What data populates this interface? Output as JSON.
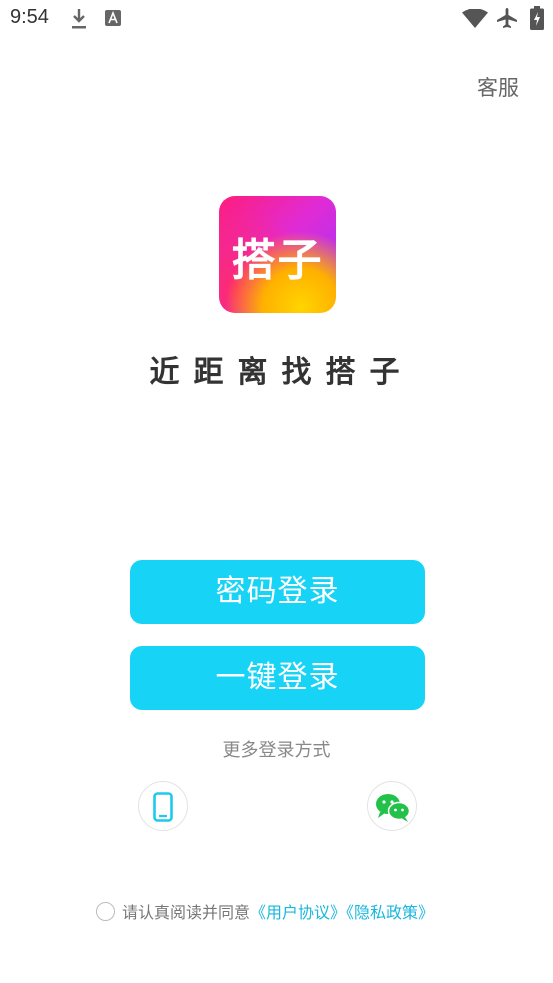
{
  "status_bar": {
    "time": "9:54",
    "icons": [
      "download-icon",
      "font-icon",
      "wifi-icon",
      "airplane-mode-icon",
      "battery-charging-icon"
    ]
  },
  "header": {
    "service_label": "客服"
  },
  "logo": {
    "text": "搭子"
  },
  "slogan": "近距离找搭子",
  "buttons": {
    "password_login": "密码登录",
    "one_key_login": "一键登录"
  },
  "more_login": {
    "label": "更多登录方式",
    "methods": [
      "phone-icon",
      "wechat-icon"
    ]
  },
  "agreement": {
    "prefix": "请认真阅读并同意",
    "user_agreement": "《用户协议》",
    "privacy_policy": "《隐私政策》",
    "checked": false
  },
  "colors": {
    "accent": "#17d3f5",
    "link": "#19b7dd",
    "wechat_green": "#22c24a"
  }
}
